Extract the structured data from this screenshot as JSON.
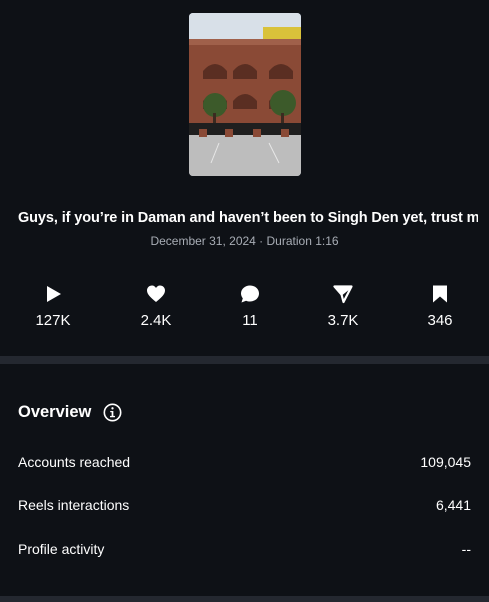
{
  "post": {
    "caption": "Guys, if you’re in Daman and haven’t been to Singh Den yet, trust me, ...",
    "date": "December 31, 2024",
    "separator": " · ",
    "duration": "Duration 1:16"
  },
  "stats": [
    {
      "icon": "play-icon",
      "value": "127K"
    },
    {
      "icon": "heart-icon",
      "value": "2.4K"
    },
    {
      "icon": "comment-icon",
      "value": "11"
    },
    {
      "icon": "share-icon",
      "value": "3.7K"
    },
    {
      "icon": "bookmark-icon",
      "value": "346"
    }
  ],
  "overview": {
    "title": "Overview",
    "info_icon": "info-icon",
    "rows": [
      {
        "label": "Accounts reached",
        "value": "109,045"
      },
      {
        "label": "Reels interactions",
        "value": "6,441"
      },
      {
        "label": "Profile activity",
        "value": "--"
      }
    ]
  },
  "colors": {
    "background": "#0e1116",
    "divider": "#242830",
    "muted_text": "#a8adb5"
  }
}
